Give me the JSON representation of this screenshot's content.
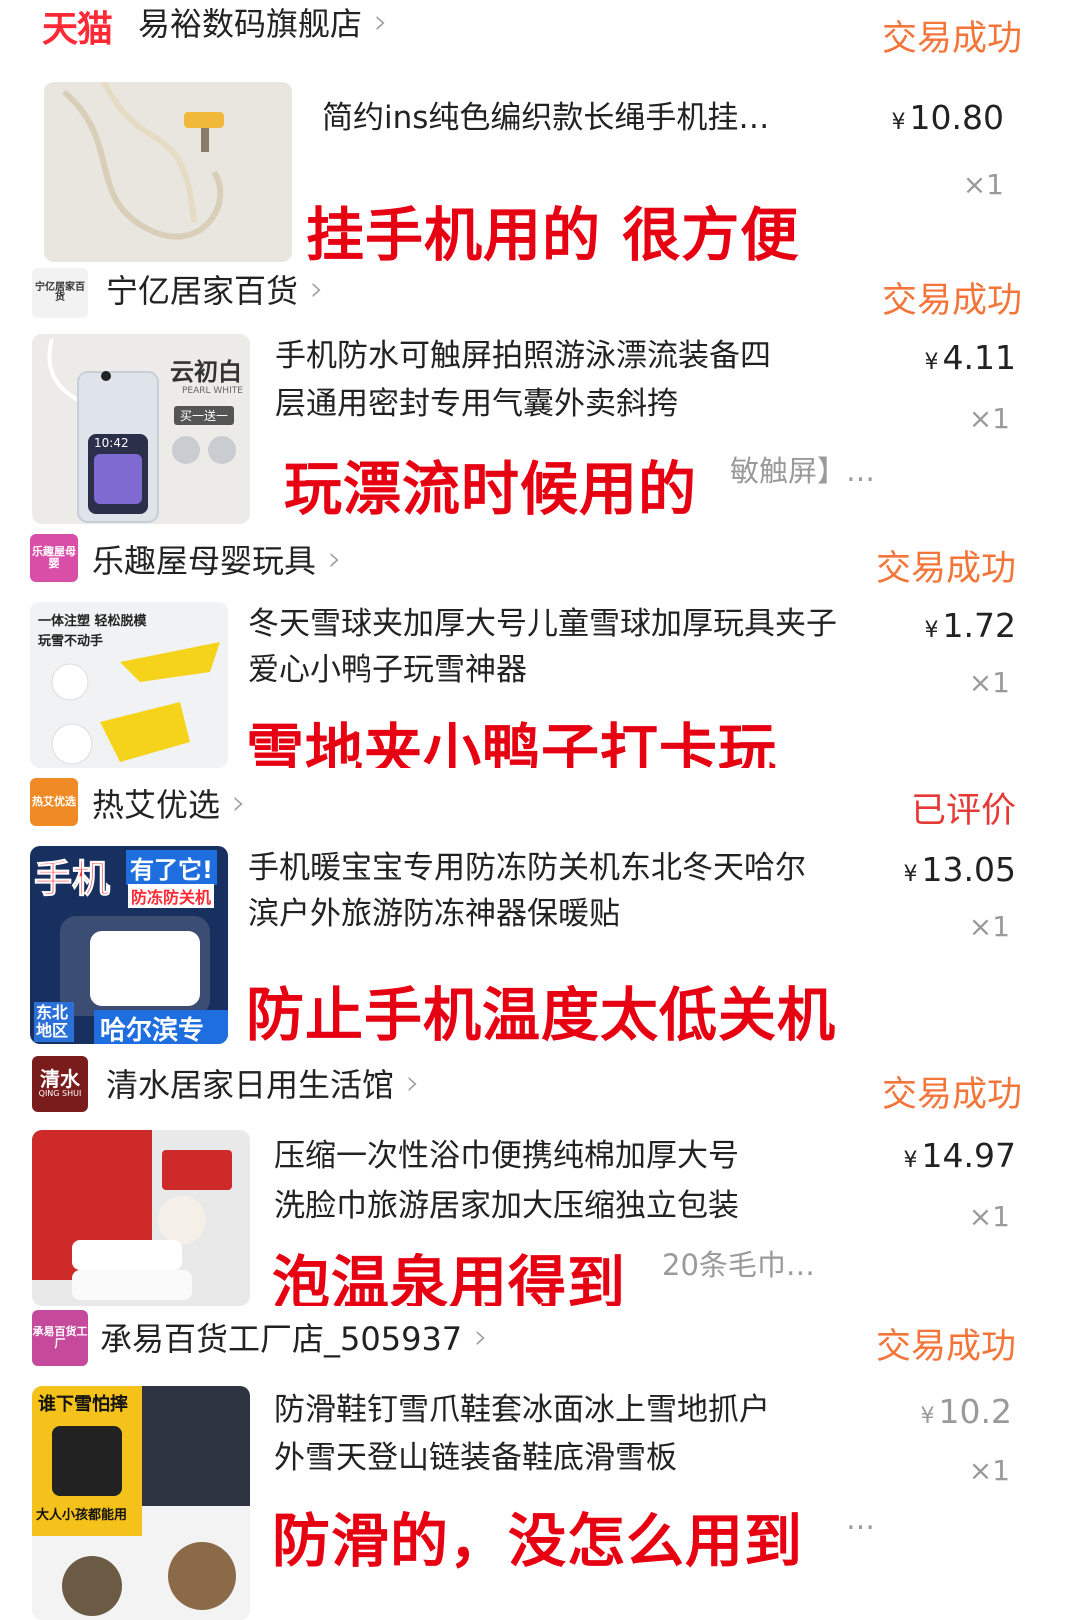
{
  "orders": [
    {
      "platform_badge": "天猫",
      "shop_name": "易裕数码旗舰店",
      "status": "交易成功",
      "title_line1": "简约ins纯色编织款长绳手机挂…",
      "title_line2": "",
      "price_symbol": "¥",
      "price": "10.80",
      "quantity": "×1",
      "sku": "",
      "caption": "挂手机用的 很方便"
    },
    {
      "shop_logo_text": "宁亿居家百货",
      "shop_name": "宁亿居家百货",
      "status": "交易成功",
      "title_line1": "手机防水可触屏拍照游泳漂流装备四",
      "title_line2": "层通用密封专用气囊外卖斜挎",
      "price_symbol": "¥",
      "price": "4.11",
      "quantity": "×1",
      "sku": "敏触屏】…",
      "caption": "玩漂流时候用的",
      "thumb_brand": "云初白",
      "thumb_sub": "PEARL WHITE",
      "thumb_promo": "买一送一",
      "thumb_time": "10:42"
    },
    {
      "shop_logo_text": "乐趣屋母婴",
      "shop_name": "乐趣屋母婴玩具",
      "status": "交易成功",
      "title_line1": "冬天雪球夹加厚大号儿童雪球加厚玩具夹子",
      "title_line2": "爱心小鸭子玩雪神器",
      "price_symbol": "¥",
      "price": "1.72",
      "quantity": "×1",
      "sku": "",
      "caption": "雪地夹小鸭子打卡玩",
      "thumb_text1": "一体注塑 轻松脱模",
      "thumb_text2": "玩雪不动手"
    },
    {
      "shop_logo_text": "热艾优选",
      "shop_name": "热艾优选",
      "status": "已评价",
      "title_line1": "手机暖宝宝专用防冻防关机东北冬天哈尔",
      "title_line2": "滨户外旅游防冻神器保暖贴",
      "price_symbol": "¥",
      "price": "13.05",
      "quantity": "×1",
      "sku": "",
      "caption": "防止手机温度太低关机",
      "thumb_text1": "手机",
      "thumb_text2": "有了它!",
      "thumb_text3": "防冻防关机",
      "thumb_text4": "东北地区",
      "thumb_text5": "哈尔滨专用"
    },
    {
      "shop_logo_text": "清水",
      "shop_logo_sub": "QING SHUI",
      "shop_name": "清水居家日用生活馆",
      "status": "交易成功",
      "title_line1": "压缩一次性浴巾便携纯棉加厚大号",
      "title_line2": "洗脸巾旅游居家加大压缩独立包装",
      "price_symbol": "¥",
      "price": "14.97",
      "quantity": "×1",
      "sku": "20条毛巾…",
      "caption": "泡温泉用得到"
    },
    {
      "shop_logo_text": "承易百货工厂",
      "shop_name": "承易百货工厂店_505937",
      "status": "交易成功",
      "title_line1": "防滑鞋钉雪爪鞋套冰面冰上雪地抓户",
      "title_line2": "外雪天登山链装备鞋底滑雪板",
      "price_symbol": "¥",
      "price": "10.2",
      "quantity": "×1",
      "sku": "…",
      "caption": "防滑的，没怎么用到",
      "thumb_text1": "谁下雪怕摔",
      "thumb_text2": "大人小孩都能用"
    }
  ],
  "colors": {
    "status": "#f4753a",
    "status_reviewed": "#e53935",
    "caption": "#e60012",
    "tmall": "#ff2a35"
  },
  "icons": [
    "chevron-right-icon"
  ]
}
